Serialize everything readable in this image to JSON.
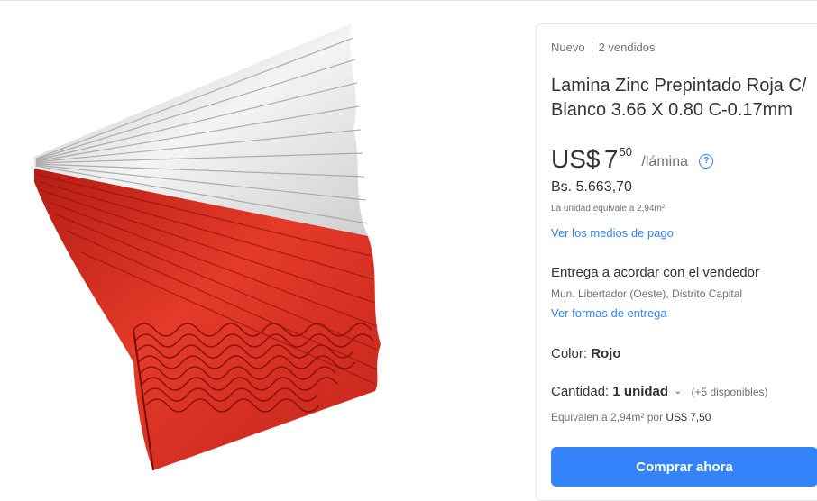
{
  "product": {
    "condition": "Nuevo",
    "sold": "2 vendidos",
    "title": "Lamina Zinc Prepintado Roja C/ Blanco 3.66 X 0.80 C-0.17mm",
    "image_alt": "Láminas de zinc onduladas rojas y blancas"
  },
  "price": {
    "currency": "US$",
    "amount": "7",
    "cents": "50",
    "unit": "/lámina",
    "local": "Bs. 5.663,70",
    "unit_equivalence": "La unidad equivale a 2,94m²"
  },
  "links": {
    "payment": "Ver los medios de pago",
    "delivery": "Ver formas de entrega"
  },
  "delivery": {
    "title": "Entrega a acordar con el vendedor",
    "location": "Mun. Libertador (Oeste), Distrito Capital"
  },
  "color": {
    "label": "Color:",
    "value": "Rojo"
  },
  "quantity": {
    "label": "Cantidad:",
    "selected": "1 unidad",
    "available": "(+5 disponibles)",
    "equivalence_prefix": "Equivalen a 2,94m² por",
    "equivalence_price": "US$ 7,50"
  },
  "actions": {
    "buy_now": "Comprar ahora"
  },
  "colors": {
    "accent": "#3483fa",
    "sheet_red": "#d8281c",
    "sheet_white": "#f2f2f2"
  }
}
